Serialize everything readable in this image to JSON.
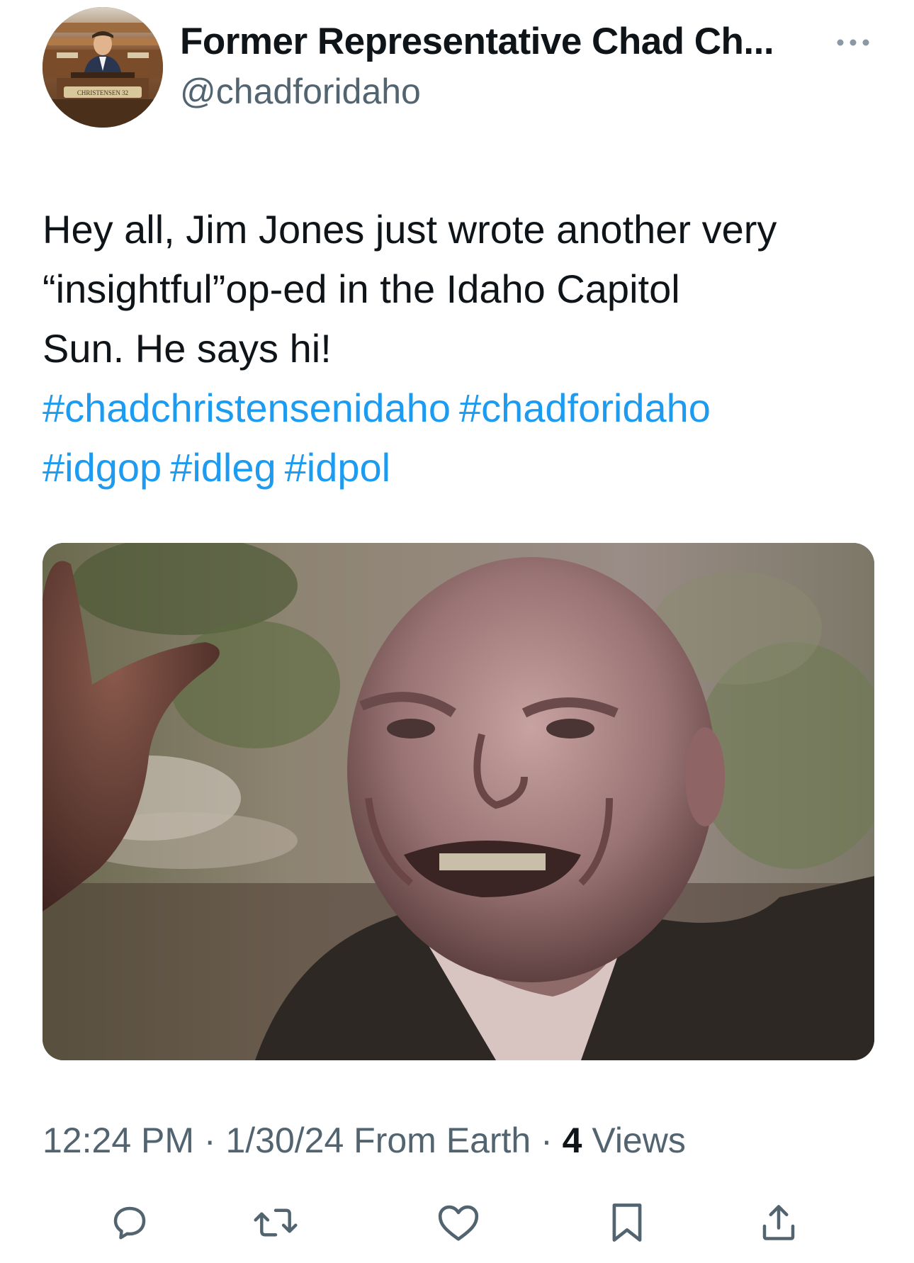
{
  "author": {
    "display_name": "Former Representative Chad Ch...",
    "handle": "@chadforidaho",
    "avatar_nameplate": "CHRISTENSEN 32"
  },
  "tweet": {
    "text_lines": [
      "Hey all, Jim Jones just wrote another very",
      "“insightful”op-ed in the Idaho Capitol",
      "Sun. He says hi!"
    ],
    "hashtags": [
      "#chadchristensenidaho",
      "#chadforidaho",
      "#idgop",
      "#idleg",
      "#idpol"
    ],
    "media_type": "gif"
  },
  "meta": {
    "time": "12:24 PM",
    "separator1": " · ",
    "date": "1/30/24",
    "source": " From Earth",
    "separator2": " · ",
    "views_count": "4",
    "views_label": " Views"
  },
  "actions": [
    {
      "name": "reply",
      "icon": "reply-icon"
    },
    {
      "name": "retweet",
      "icon": "retweet-icon"
    },
    {
      "name": "like",
      "icon": "heart-icon"
    },
    {
      "name": "bookmark",
      "icon": "bookmark-icon"
    },
    {
      "name": "share",
      "icon": "share-icon"
    }
  ],
  "colors": {
    "text": "#0f1419",
    "secondary": "#536471",
    "link": "#1d9bf0"
  }
}
